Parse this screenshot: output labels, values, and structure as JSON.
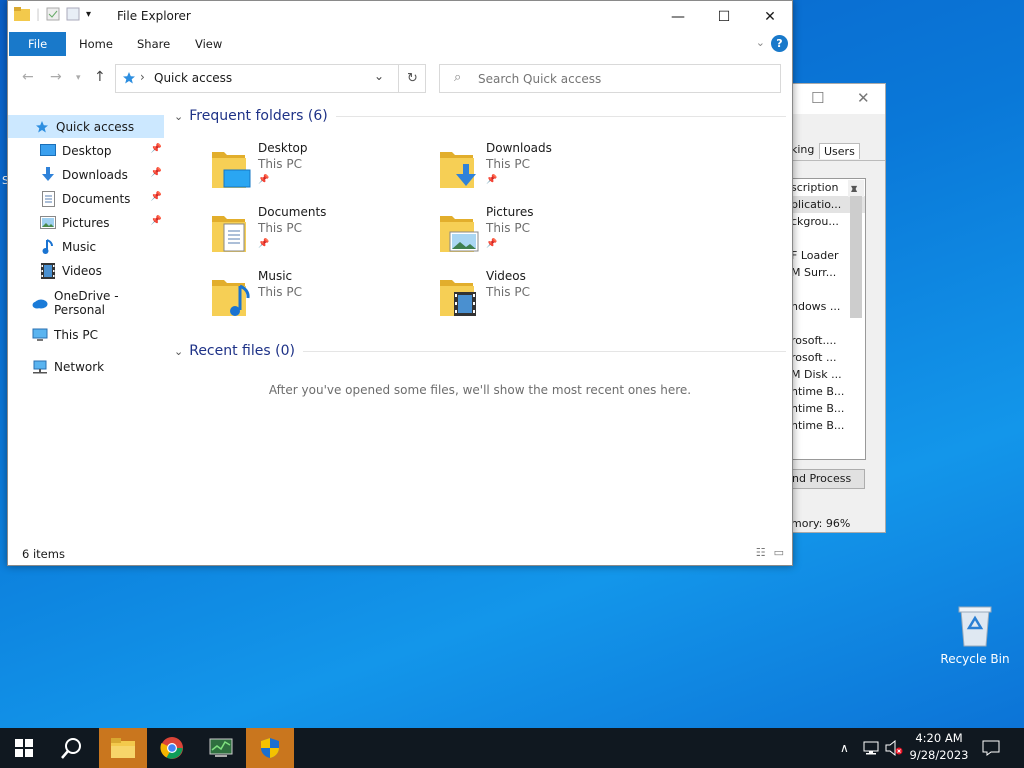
{
  "desktop": {
    "edge_text": "S",
    "recycle_bin": "Recycle Bin"
  },
  "task_manager": {
    "tab_partial": "king",
    "tab_users": "Users",
    "rows": [
      "scription",
      "plicatio...",
      "ckgrou...",
      "",
      "F Loader",
      "M Surr...",
      "",
      "ndows ...",
      "",
      "rosoft....",
      "rosoft ...",
      "M Disk ...",
      "ntime B...",
      "ntime B...",
      "ntime B..."
    ],
    "selected_row": 1,
    "end_button": "nd Process",
    "memory": "mory: 96%"
  },
  "explorer": {
    "title": "File Explorer",
    "ribbon_tabs": [
      "File",
      "Home",
      "Share",
      "View"
    ],
    "address": "Quick access",
    "search_placeholder": "Search Quick access",
    "nav": {
      "quick_access": "Quick access",
      "pinned": [
        {
          "label": "Desktop",
          "icon": "desktop-icon",
          "pinned": true
        },
        {
          "label": "Downloads",
          "icon": "downloads-icon",
          "pinned": true
        },
        {
          "label": "Documents",
          "icon": "documents-icon",
          "pinned": true
        },
        {
          "label": "Pictures",
          "icon": "pictures-icon",
          "pinned": true
        },
        {
          "label": "Music",
          "icon": "music-icon",
          "pinned": false
        },
        {
          "label": "Videos",
          "icon": "videos-icon",
          "pinned": false
        }
      ],
      "onedrive": "OneDrive - Personal",
      "this_pc": "This PC",
      "network": "Network"
    },
    "frequent_header": "Frequent folders (6)",
    "folders": [
      {
        "name": "Desktop",
        "location": "This PC",
        "pinned": true,
        "overlay": "desktop"
      },
      {
        "name": "Downloads",
        "location": "This PC",
        "pinned": true,
        "overlay": "downloads"
      },
      {
        "name": "Documents",
        "location": "This PC",
        "pinned": true,
        "overlay": "documents"
      },
      {
        "name": "Pictures",
        "location": "This PC",
        "pinned": true,
        "overlay": "pictures"
      },
      {
        "name": "Music",
        "location": "This PC",
        "pinned": false,
        "overlay": "music"
      },
      {
        "name": "Videos",
        "location": "This PC",
        "pinned": false,
        "overlay": "videos"
      }
    ],
    "recent_header": "Recent files (0)",
    "recent_empty": "After you've opened some files, we'll show the most recent ones here.",
    "status": "6 items"
  },
  "taskbar": {
    "time": "4:20 AM",
    "date": "9/28/2023"
  },
  "colors": {
    "accent": "#1979ca",
    "taskbar": "#101820",
    "active": "#c9761e",
    "folder": "#f3c94c"
  }
}
